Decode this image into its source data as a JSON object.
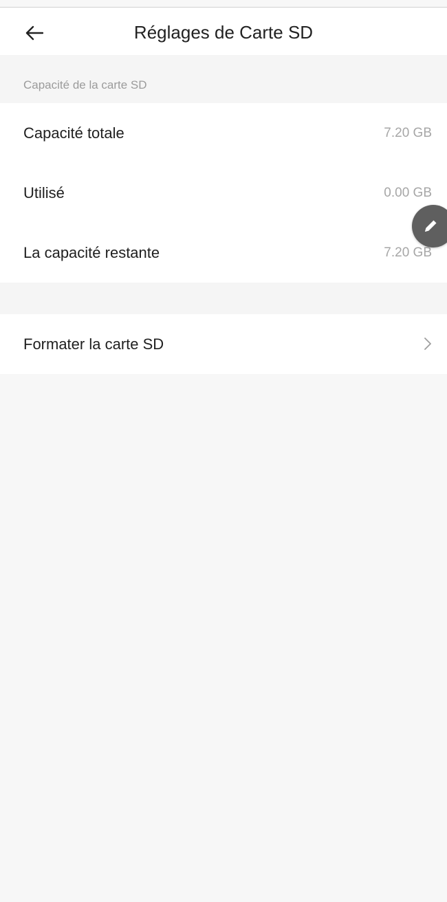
{
  "header": {
    "title": "Réglages de Carte SD",
    "back_icon": "arrow-left-icon"
  },
  "section": {
    "title": "Capacité de la carte SD"
  },
  "capacity": {
    "rows": [
      {
        "label": "Capacité totale",
        "value": "7.20 GB"
      },
      {
        "label": "Utilisé",
        "value": "0.00 GB"
      },
      {
        "label": "La capacité restante",
        "value": "7.20 GB"
      }
    ]
  },
  "format": {
    "label": "Formater la carte SD",
    "icon": "chevron-right-icon"
  },
  "floating_button": {
    "icon": "pencil-icon",
    "color": "#5f5f5f"
  }
}
